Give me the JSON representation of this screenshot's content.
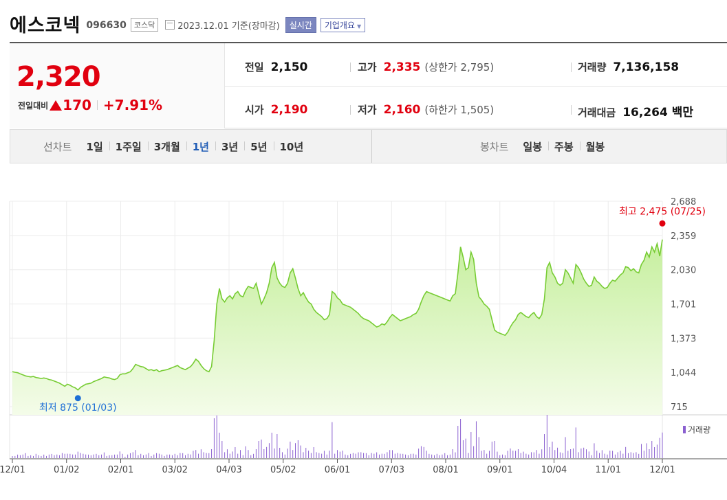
{
  "header": {
    "name": "에스코넥",
    "code": "096630",
    "market": "코스닥",
    "date": "2023.12.01 기준(장마감)",
    "realtime_btn": "실시간",
    "overview_btn": "기업개요"
  },
  "quote": {
    "current": "2,320",
    "change_label": "전일대비",
    "change": "170",
    "change_pct": "+7.91%",
    "prev_close": {
      "label": "전일",
      "value": "2,150"
    },
    "open": {
      "label": "시가",
      "value": "2,190"
    },
    "high": {
      "label": "고가",
      "value": "2,335",
      "limit": "(상한가 2,795)"
    },
    "low": {
      "label": "저가",
      "value": "2,160",
      "limit": "(하한가 1,505)"
    },
    "volume": {
      "label": "거래량",
      "value": "7,136,158"
    },
    "amount": {
      "label": "거래대금",
      "value": "16,264 백만"
    }
  },
  "periods": {
    "line_label": "선차트",
    "line_items": [
      "1일",
      "1주일",
      "3개월",
      "1년",
      "3년",
      "5년",
      "10년"
    ],
    "active": "1년",
    "candle_label": "봉차트",
    "candle_items": [
      "일봉",
      "주봉",
      "월봉"
    ]
  },
  "colors": {
    "up": "#e1000f",
    "line": "#77cc33",
    "fill_top": "#c6ef9e",
    "low_marker": "#1e6fd6",
    "volume_bar": "#8a5fd0",
    "active_tab": "#1e5bb5"
  },
  "chart_data": {
    "type": "area",
    "x_ticks": [
      "12/01",
      "01/02",
      "02/01",
      "03/02",
      "04/03",
      "05/02",
      "06/01",
      "07/03",
      "08/01",
      "09/01",
      "10/04",
      "11/01",
      "12/01"
    ],
    "y_ticks": [
      "2,688",
      "2,359",
      "2,030",
      "1,701",
      "1,373",
      "1,044",
      "715"
    ],
    "y_range": [
      715,
      2688
    ],
    "max_annotation": "최고 2,475 (07/25)",
    "min_annotation": "최저 875 (01/03)",
    "max_point": {
      "date": "07/25",
      "value": 2475
    },
    "min_point": {
      "date": "01/03",
      "value": 875
    },
    "volume_label": "거래량",
    "price_series": [
      1050,
      1045,
      1040,
      1030,
      1020,
      1010,
      1005,
      1000,
      1005,
      995,
      990,
      985,
      990,
      985,
      975,
      970,
      960,
      950,
      940,
      925,
      910,
      930,
      920,
      905,
      895,
      875,
      900,
      915,
      930,
      935,
      940,
      955,
      965,
      975,
      985,
      1000,
      995,
      990,
      980,
      975,
      985,
      1020,
      1030,
      1030,
      1040,
      1050,
      1080,
      1120,
      1110,
      1100,
      1095,
      1080,
      1065,
      1070,
      1060,
      1070,
      1050,
      1060,
      1065,
      1070,
      1080,
      1090,
      1100,
      1110,
      1090,
      1080,
      1070,
      1085,
      1100,
      1130,
      1170,
      1150,
      1110,
      1080,
      1060,
      1050,
      1100,
      1350,
      1700,
      1850,
      1750,
      1720,
      1760,
      1780,
      1750,
      1800,
      1820,
      1780,
      1770,
      1830,
      1870,
      1860,
      1850,
      1900,
      1800,
      1700,
      1750,
      1810,
      1900,
      2050,
      2100,
      1950,
      1900,
      1870,
      1860,
      1900,
      2000,
      2040,
      1950,
      1850,
      1780,
      1810,
      1760,
      1720,
      1700,
      1650,
      1620,
      1600,
      1580,
      1550,
      1560,
      1600,
      1820,
      1800,
      1760,
      1740,
      1700,
      1690,
      1680,
      1670,
      1650,
      1630,
      1610,
      1580,
      1560,
      1550,
      1540,
      1520,
      1500,
      1480,
      1490,
      1510,
      1500,
      1530,
      1570,
      1600,
      1580,
      1560,
      1540,
      1550,
      1560,
      1570,
      1580,
      1600,
      1610,
      1650,
      1720,
      1780,
      1820,
      1810,
      1800,
      1790,
      1780,
      1770,
      1760,
      1750,
      1740,
      1730,
      1780,
      1800,
      2000,
      2250,
      2150,
      2030,
      2050,
      2200,
      2130,
      1900,
      1770,
      1740,
      1700,
      1680,
      1650,
      1550,
      1450,
      1430,
      1420,
      1410,
      1400,
      1430,
      1480,
      1520,
      1550,
      1600,
      1620,
      1600,
      1580,
      1570,
      1600,
      1620,
      1580,
      1560,
      1600,
      1750,
      2050,
      2100,
      2000,
      1960,
      1900,
      1880,
      1900,
      2030,
      2000,
      1950,
      1900,
      2080,
      2050,
      2000,
      1940,
      1900,
      1870,
      1880,
      1960,
      1920,
      1900,
      1870,
      1850,
      1860,
      1900,
      1930,
      1920,
      1950,
      1980,
      2000,
      2060,
      2050,
      2020,
      2040,
      2010,
      2000,
      2080,
      2120,
      2200,
      2150,
      2250,
      2200,
      2280,
      2160,
      2320
    ]
  }
}
